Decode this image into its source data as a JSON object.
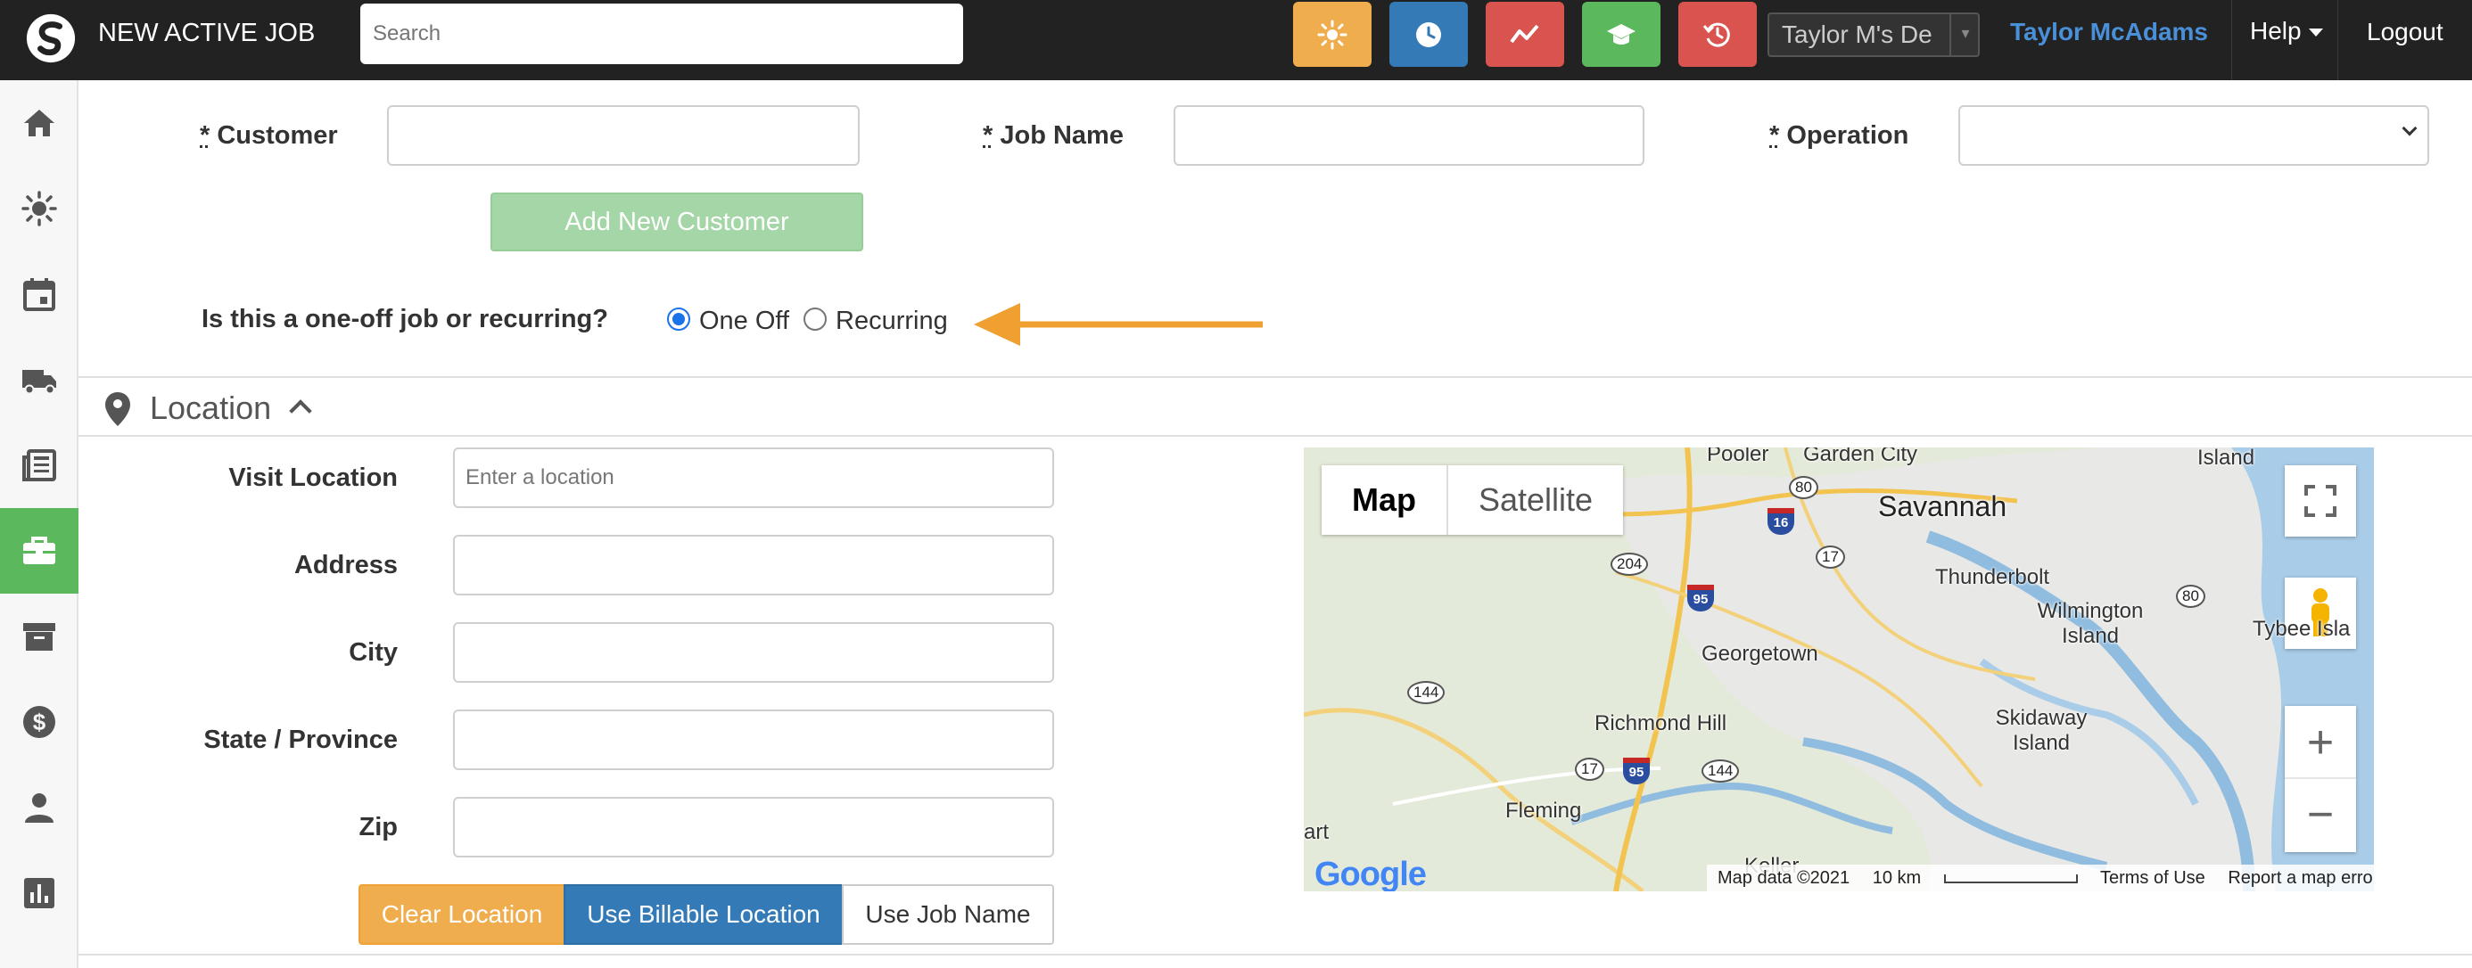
{
  "header": {
    "app_title": "NEW ACTIVE JOB",
    "search_placeholder": "Search",
    "quick_buttons": [
      {
        "icon": "sun-icon",
        "color": "#f0ad4e"
      },
      {
        "icon": "clock-icon",
        "color": "#337ab7"
      },
      {
        "icon": "trend-icon",
        "color": "#d9534f"
      },
      {
        "icon": "graduation-cap-icon",
        "color": "#5cb85c"
      },
      {
        "icon": "history-icon",
        "color": "#d9534f"
      }
    ],
    "company_select": "Taylor M's De",
    "user_name": "Taylor McAdams",
    "help_label": "Help",
    "logout_label": "Logout"
  },
  "sidebar": {
    "items": [
      {
        "icon": "home-icon",
        "active": false
      },
      {
        "icon": "sun-icon",
        "active": false
      },
      {
        "icon": "calendar-icon",
        "active": false
      },
      {
        "icon": "truck-icon",
        "active": false
      },
      {
        "icon": "newspaper-icon",
        "active": false
      },
      {
        "icon": "briefcase-icon",
        "active": true
      },
      {
        "icon": "archive-icon",
        "active": false
      },
      {
        "icon": "dollar-icon",
        "active": false
      },
      {
        "icon": "user-icon",
        "active": false
      },
      {
        "icon": "bar-chart-icon",
        "active": false
      }
    ]
  },
  "form": {
    "required_marker": "*",
    "customer_label": "Customer",
    "customer_value": "",
    "job_name_label": "Job Name",
    "job_name_value": "",
    "operation_label": "Operation",
    "operation_value": "",
    "add_customer_label": "Add New Customer",
    "recurrence_question": "Is this a one-off job or recurring?",
    "one_off_label": "One Off",
    "recurring_label": "Recurring",
    "selected_recurrence": "One Off",
    "arrow_color": "#f0a030"
  },
  "location": {
    "title": "Location",
    "visit_location_label": "Visit Location",
    "visit_location_placeholder": "Enter a location",
    "address_label": "Address",
    "city_label": "City",
    "state_label": "State / Province",
    "zip_label": "Zip",
    "clear_button": "Clear Location",
    "billable_button": "Use Billable Location",
    "job_name_button": "Use Job Name"
  },
  "map": {
    "map_tab": "Map",
    "satellite_tab": "Satellite",
    "places": [
      "Pooler",
      "Garden City",
      "Savannah",
      "Island",
      "Thunderbolt",
      "Wilmington Island",
      "Tybee Isla",
      "Georgetown",
      "Richmond Hill",
      "Skidaway Island",
      "Fleming",
      "art",
      "Keller"
    ],
    "highways": [
      "80",
      "16",
      "17",
      "204",
      "95",
      "80",
      "144",
      "17",
      "95",
      "144"
    ],
    "logo": "Google",
    "attribution": "Map data ©2021",
    "scale": "10 km",
    "terms": "Terms of Use",
    "report": "Report a map error"
  }
}
